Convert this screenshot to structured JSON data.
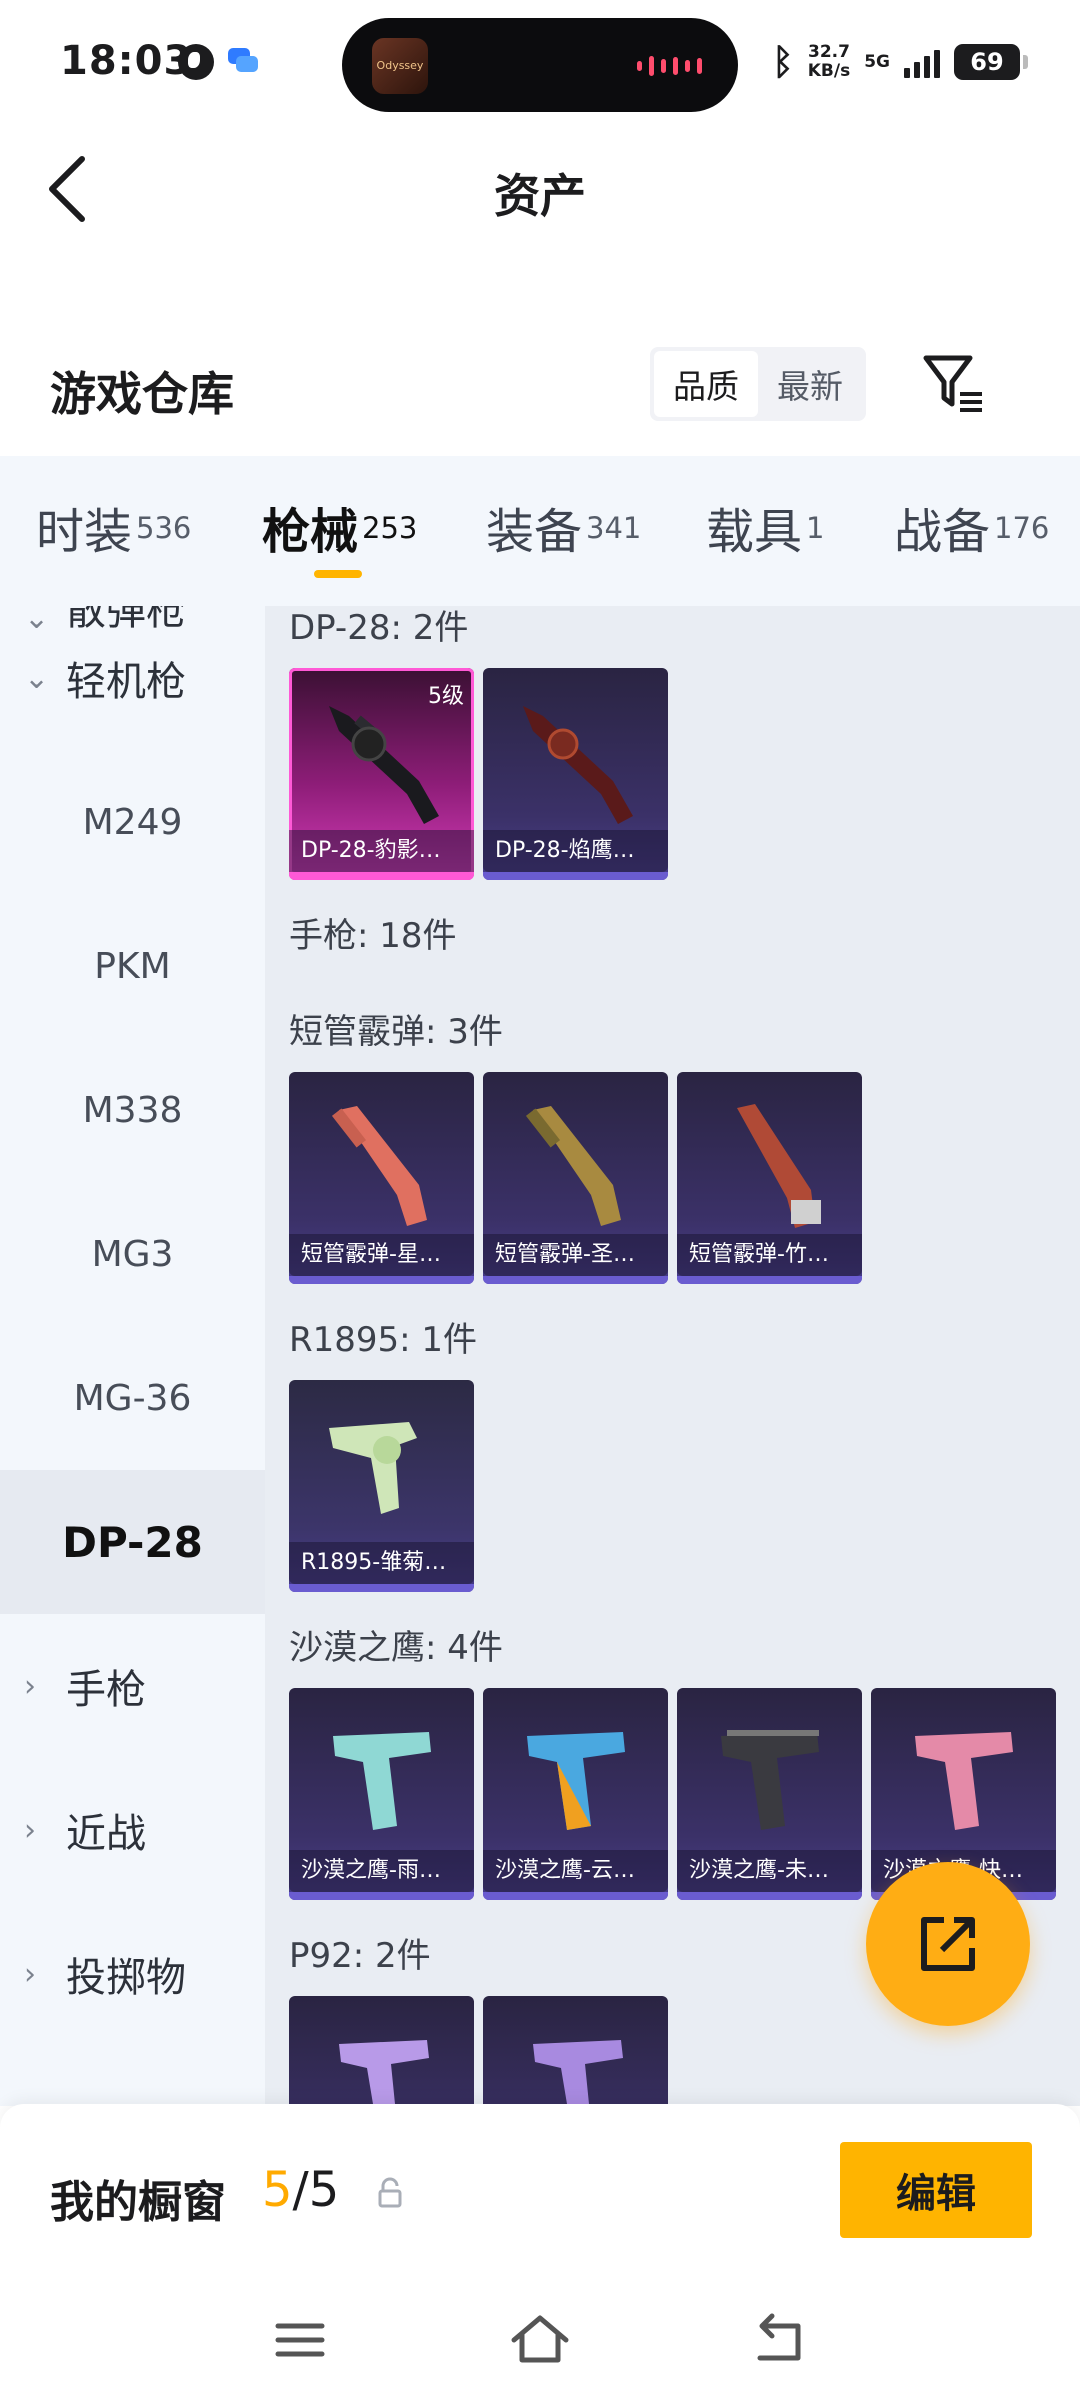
{
  "status_bar": {
    "time": "18:03",
    "island_app": "Odyssey",
    "net_speed_value": "32.7",
    "net_speed_unit": "KB/s",
    "network_type": "5G",
    "battery": "69"
  },
  "header": {
    "title": "资产"
  },
  "warehouse": {
    "title": "游戏仓库",
    "sort_options": [
      "品质",
      "最新"
    ],
    "active_sort": "品质"
  },
  "tabs": [
    {
      "label": "时装",
      "count": "536"
    },
    {
      "label": "枪械",
      "count": "253",
      "active": true
    },
    {
      "label": "装备",
      "count": "341"
    },
    {
      "label": "载具",
      "count": "1"
    },
    {
      "label": "战备",
      "count": "176"
    }
  ],
  "sidenav": {
    "cut_item": "散弹枪",
    "group_lmg": "轻机枪",
    "sub_items": [
      "M249",
      "PKM",
      "M338",
      "MG3",
      "MG-36",
      "DP-28"
    ],
    "active_item": "DP-28",
    "group_pistol": "手枪",
    "group_melee": "近战",
    "group_throwable": "投掷物"
  },
  "content": {
    "groups": [
      {
        "title": "DP-28: 2件",
        "items": [
          {
            "label": "DP-28-豹影…",
            "level": "5级",
            "rarity": "pink"
          },
          {
            "label": "DP-28-焰鹰…",
            "rarity": "purple"
          }
        ]
      },
      {
        "title": "手枪: 18件",
        "items": []
      },
      {
        "title": "短管霰弹: 3件",
        "items": [
          {
            "label": "短管霰弹-星…",
            "rarity": "purple"
          },
          {
            "label": "短管霰弹-圣…",
            "rarity": "purple"
          },
          {
            "label": "短管霰弹-竹…",
            "rarity": "purple"
          }
        ]
      },
      {
        "title": "R1895: 1件",
        "items": [
          {
            "label": "R1895-雏菊…",
            "rarity": "purple"
          }
        ]
      },
      {
        "title": "沙漠之鹰: 4件",
        "items": [
          {
            "label": "沙漠之鹰-雨…",
            "rarity": "purple"
          },
          {
            "label": "沙漠之鹰-云…",
            "rarity": "purple"
          },
          {
            "label": "沙漠之鹰-未…",
            "rarity": "purple"
          },
          {
            "label": "沙漠之鹰-快…",
            "rarity": "purple"
          }
        ]
      },
      {
        "title": "P92: 2件",
        "items": [
          {
            "label": "",
            "rarity": "purple"
          },
          {
            "label": "",
            "rarity": "purple"
          }
        ]
      }
    ]
  },
  "bottom_bar": {
    "showcase_label": "我的橱窗",
    "showcase_current": "5",
    "showcase_sep_total": "/5",
    "edit_label": "编辑"
  },
  "icons": {
    "back": "back-chevron-icon",
    "filter": "filter-funnel-icon",
    "fab": "share-external-icon",
    "lock": "lock-icon"
  },
  "colors": {
    "accent": "#ffb400",
    "showcase_current": "#ffaa00",
    "tab_bg": "#f3f7fc",
    "content_bg": "#e9edf3",
    "card_purple": "#3b3168",
    "card_pink": "#d43cb8"
  }
}
